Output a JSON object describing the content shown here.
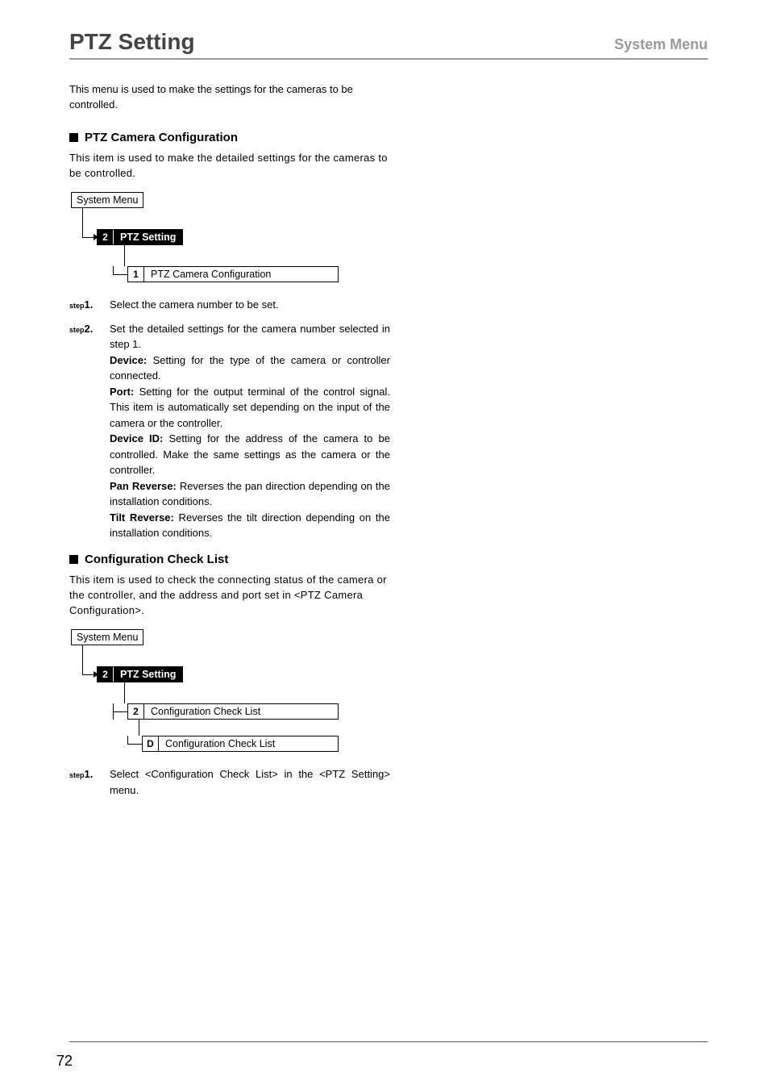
{
  "header": {
    "title": "PTZ Setting",
    "menu": "System Menu"
  },
  "intro": "This menu is used to make the settings for the cameras to be controlled.",
  "section1": {
    "heading": "PTZ Camera Configuration",
    "desc": "This item is used to make the detailed settings for the cameras to be controlled.",
    "tree": {
      "root": "System Menu",
      "node_num": "2",
      "node_label": "PTZ Setting",
      "leaf_num": "1",
      "leaf_label": "PTZ Camera Configuration"
    },
    "steps": [
      {
        "tag": "step",
        "num": "1.",
        "text": "Select the camera number to be set."
      },
      {
        "tag": "step",
        "num": "2.",
        "text_intro": "Set the detailed settings for the camera number selected in step 1.",
        "defs": [
          {
            "term": "Device:",
            "body": " Setting for the type of the camera or controller connected."
          },
          {
            "term": "Port:",
            "body": " Setting for the output terminal of the control signal. This item is automatically set depending on the input of the camera or the controller."
          },
          {
            "term": "Device ID:",
            "body": " Setting for the address of the camera to be controlled. Make the same settings as the camera or the controller."
          },
          {
            "term": "Pan Reverse:",
            "body": " Reverses the pan direction depending on the installation conditions."
          },
          {
            "term": "Tilt Reverse:",
            "body": " Reverses the tilt direction depending on the installation conditions."
          }
        ]
      }
    ]
  },
  "section2": {
    "heading": "Configuration Check List",
    "desc": "This item is used to check the connecting status of the camera or the controller, and the address and port set in <PTZ Camera Configuration>.",
    "tree": {
      "root": "System Menu",
      "node_num": "2",
      "node_label": "PTZ Setting",
      "leaf_num": "2",
      "leaf_label": "Configuration Check List",
      "leaf2_num": "D",
      "leaf2_label": "Configuration Check List"
    },
    "steps": [
      {
        "tag": "step",
        "num": "1.",
        "text": "Select <Configuration Check List> in the <PTZ Setting> menu."
      }
    ]
  },
  "page_number": "72"
}
